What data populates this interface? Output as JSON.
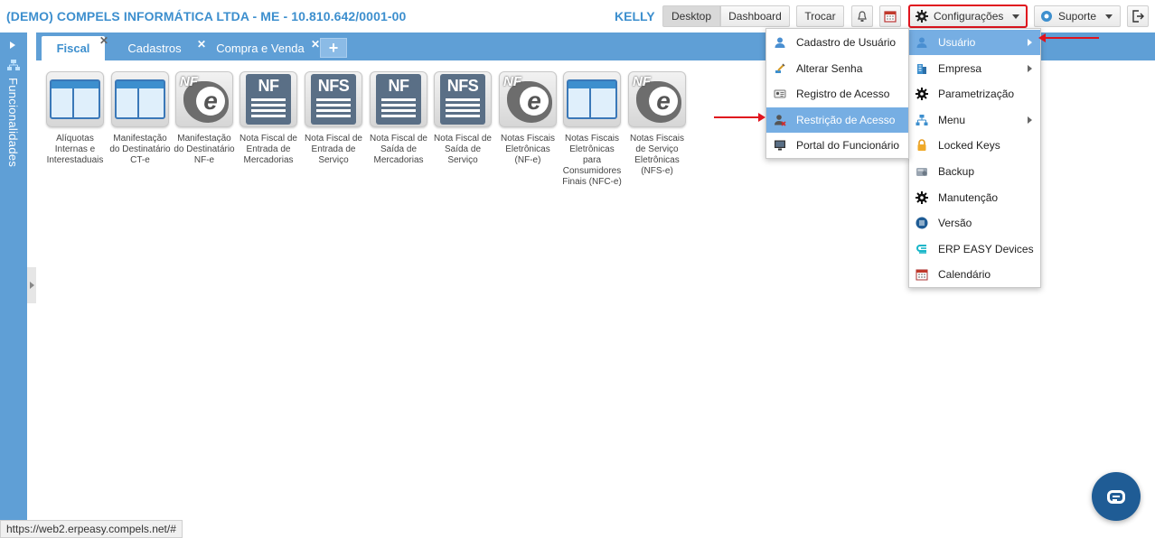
{
  "header": {
    "company": "(DEMO) COMPELS INFORMÁTICA LTDA - ME - 10.810.642/0001-00",
    "user": "KELLY",
    "buttons": {
      "desktop": "Desktop",
      "dashboard": "Dashboard",
      "trocar": "Trocar",
      "configuracoes": "Configurações",
      "suporte": "Suporte"
    }
  },
  "sidebar": {
    "label": "Funcionalidades"
  },
  "tabs": [
    {
      "label": "Fiscal",
      "active": true
    },
    {
      "label": "Cadastros",
      "active": false
    },
    {
      "label": "Compra e Venda",
      "active": false
    }
  ],
  "apps": [
    {
      "label": "Alíquotas Internas e Interestaduais",
      "icon": "window-icon"
    },
    {
      "label": "Manifestação do Destinatário CT-e",
      "icon": "window-icon"
    },
    {
      "label": "Manifestação do Destinatário NF-e",
      "icon": "nfe-icon"
    },
    {
      "label": "Nota Fiscal de Entrada de Mercadorias",
      "icon": "nf-doc-icon"
    },
    {
      "label": "Nota Fiscal de Entrada de Serviço",
      "icon": "nfs-doc-icon"
    },
    {
      "label": "Nota Fiscal de Saída de Mercadorias",
      "icon": "nf-doc-icon"
    },
    {
      "label": "Nota Fiscal de Saída de Serviço",
      "icon": "nfs-doc-icon"
    },
    {
      "label": "Notas Fiscais Eletrônicas (NF-e)",
      "icon": "nfe-icon"
    },
    {
      "label": "Notas Fiscais Eletrônicas para Consumidores Finais (NFC-e)",
      "icon": "window-icon"
    },
    {
      "label": "Notas Fiscais de Serviço Eletrônicas (NFS-e)",
      "icon": "nfe-icon"
    }
  ],
  "icon_text": {
    "nf": "NF",
    "nfs": "NFS",
    "nfe_prefix": "NF",
    "nfe_e": "e"
  },
  "config_menu": [
    {
      "label": "Usuário",
      "icon": "user-icon",
      "submenu": true,
      "highlighted": true
    },
    {
      "label": "Empresa",
      "icon": "building-icon",
      "submenu": true
    },
    {
      "label": "Parametrização",
      "icon": "gear-icon"
    },
    {
      "label": "Menu",
      "icon": "sitemap-icon",
      "submenu": true
    },
    {
      "label": "Locked Keys",
      "icon": "lock-icon"
    },
    {
      "label": "Backup",
      "icon": "backup-icon"
    },
    {
      "label": "Manutenção",
      "icon": "gear-icon"
    },
    {
      "label": "Versão",
      "icon": "list-icon"
    },
    {
      "label": "ERP EASY Devices",
      "icon": "devices-icon"
    },
    {
      "label": "Calendário",
      "icon": "calendar-icon"
    }
  ],
  "user_menu": [
    {
      "label": "Cadastro de Usuário",
      "icon": "user-icon"
    },
    {
      "label": "Alterar Senha",
      "icon": "key-icon"
    },
    {
      "label": "Registro de Acesso",
      "icon": "id-card-icon"
    },
    {
      "label": "Restrição de Acesso",
      "icon": "user-block-icon",
      "highlighted": true
    },
    {
      "label": "Portal do Funcionário",
      "icon": "monitor-icon"
    }
  ],
  "status_url": "https://web2.erpeasy.compels.net/#",
  "colors": {
    "brand": "#3d8fce",
    "bar": "#5f9fd6",
    "highlight": "#76aee3",
    "annotation": "#e0141e",
    "chat": "#1f5c95"
  }
}
